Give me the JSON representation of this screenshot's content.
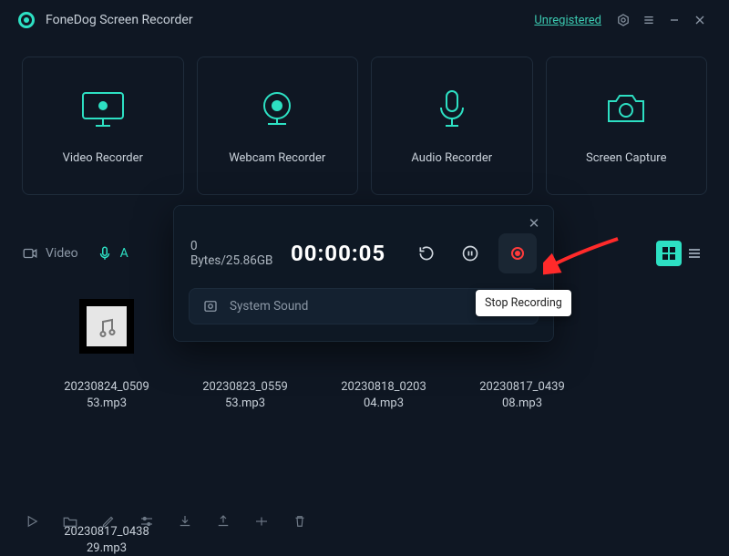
{
  "titlebar": {
    "app_name": "FoneDog Screen Recorder",
    "register_link": "Unregistered"
  },
  "cards": {
    "video": "Video Recorder",
    "webcam": "Webcam Recorder",
    "audio": "Audio Recorder",
    "screenshot": "Screen Capture"
  },
  "library": {
    "tab_video": "Video",
    "tab_audio_letter": "A"
  },
  "files": [
    {
      "name": "20230824_050953.mp3"
    },
    {
      "name": "20230823_055953.mp3"
    },
    {
      "name": "20230818_020304.mp3"
    },
    {
      "name": "20230817_043908.mp3"
    },
    {
      "name": "20230817_043829.mp3"
    }
  ],
  "recording": {
    "size_used": "0 Bytes",
    "size_total": "25.86GB",
    "timer": "00:00:05",
    "source": "System Sound",
    "tooltip": "Stop Recording"
  }
}
